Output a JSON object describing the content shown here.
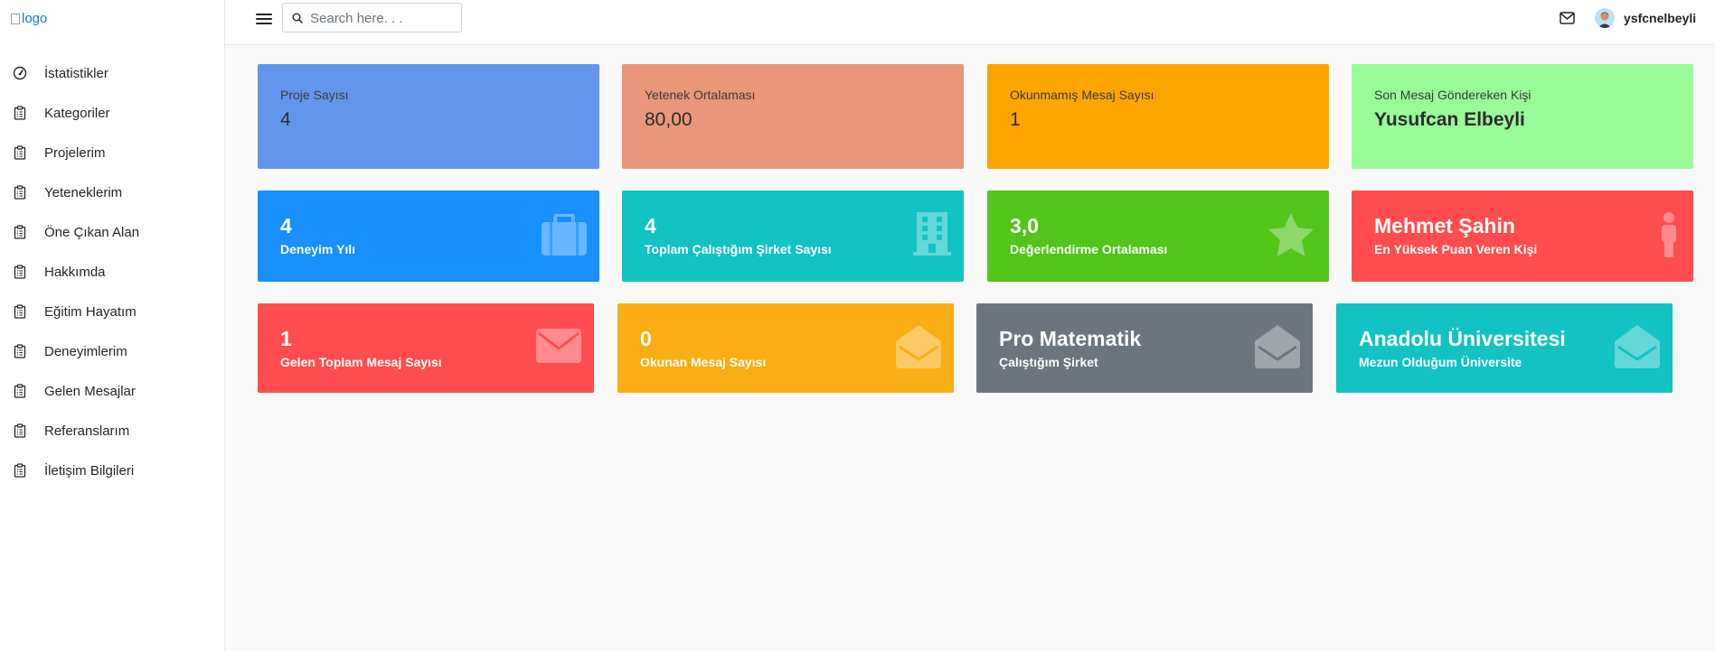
{
  "logo": {
    "alt": "logo"
  },
  "sidebar": {
    "items": [
      {
        "label": "İstatistikler",
        "icon": "gauge-icon"
      },
      {
        "label": "Kategoriler",
        "icon": "clipboard-icon"
      },
      {
        "label": "Projelerim",
        "icon": "clipboard-icon"
      },
      {
        "label": "Yeteneklerim",
        "icon": "clipboard-icon"
      },
      {
        "label": "Öne Çıkan Alan",
        "icon": "clipboard-icon"
      },
      {
        "label": "Hakkımda",
        "icon": "clipboard-icon"
      },
      {
        "label": "Eğitim Hayatım",
        "icon": "clipboard-icon"
      },
      {
        "label": "Deneyimlerim",
        "icon": "clipboard-icon"
      },
      {
        "label": "Gelen Mesajlar",
        "icon": "clipboard-icon"
      },
      {
        "label": "Referanslarım",
        "icon": "clipboard-icon"
      },
      {
        "label": "İletişim Bilgileri",
        "icon": "clipboard-icon"
      }
    ]
  },
  "topbar": {
    "search_placeholder": "Search here. . .",
    "search_value": "",
    "username": "ysfcnelbeyli"
  },
  "stats_top": [
    {
      "title": "Proje Sayısı",
      "value": "4",
      "color": "#6495ed"
    },
    {
      "title": "Yetenek Ortalaması",
      "value": "80,00",
      "color": "#e9967a"
    },
    {
      "title": "Okunmamış Mesaj Sayısı",
      "value": "1",
      "color": "#ffa500"
    },
    {
      "title": "Son Mesaj Göndereken Kişi",
      "value": "Yusufcan Elbeyli",
      "color": "#98fb98"
    }
  ],
  "stats_mid": [
    {
      "value": "4",
      "label": "Deneyim Yılı",
      "icon": "suitcase-icon",
      "color": "#1890ff"
    },
    {
      "value": "4",
      "label": "Toplam Çalıştığım Şirket Sayısı",
      "icon": "building-icon",
      "color": "#13c2c2"
    },
    {
      "value": "3,0",
      "label": "Değerlendirme Ortalaması",
      "icon": "star-icon",
      "color": "#52c41a"
    },
    {
      "value": "Mehmet Şahin",
      "label": "En Yüksek Puan Veren Kişi",
      "icon": "person-icon",
      "color": "#ff4d4f"
    }
  ],
  "stats_bot": [
    {
      "value": "1",
      "label": "Gelen Toplam Mesaj Sayısı",
      "icon": "envelope-icon",
      "color": "#ff4d4f"
    },
    {
      "value": "0",
      "label": "Okunan Mesaj Sayısı",
      "icon": "envelope-open-icon",
      "color": "#faad14"
    },
    {
      "value": "Pro Matematik",
      "label": "Çalıştığım Şirket",
      "icon": "envelope-open-icon",
      "color": "#6c757d"
    },
    {
      "value": "Anadolu Üniversitesi",
      "label": "Mezun Olduğum Üniversite",
      "icon": "envelope-open-icon",
      "color": "#13c2c2"
    }
  ]
}
